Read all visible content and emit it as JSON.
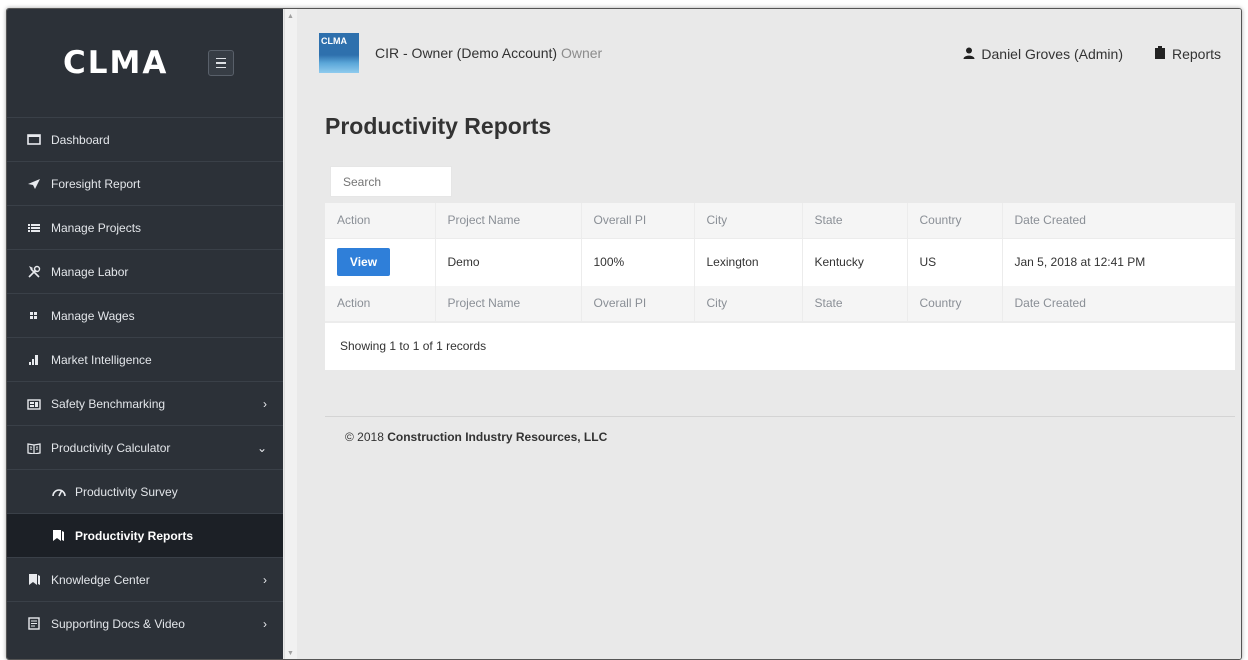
{
  "sidebar": {
    "brand": "CLMA",
    "items": [
      {
        "label": "Dashboard",
        "icon": "monitor-icon"
      },
      {
        "label": "Foresight Report",
        "icon": "paper-plane-icon"
      },
      {
        "label": "Manage Projects",
        "icon": "list-icon"
      },
      {
        "label": "Manage Labor",
        "icon": "tools-icon"
      },
      {
        "label": "Manage Wages",
        "icon": "grid-icon"
      },
      {
        "label": "Market Intelligence",
        "icon": "bar-chart-icon"
      },
      {
        "label": "Safety Benchmarking",
        "icon": "id-card-icon",
        "chevron": "›"
      },
      {
        "label": "Productivity Calculator",
        "icon": "book-icon",
        "chevron": "⌄"
      },
      {
        "label": "Productivity Survey",
        "icon": "gauge-icon"
      },
      {
        "label": "Productivity Reports",
        "icon": "bookmark-icon"
      },
      {
        "label": "Knowledge Center",
        "icon": "bookmark-icon",
        "chevron": "›"
      },
      {
        "label": "Supporting Docs & Video",
        "icon": "document-icon",
        "chevron": "›"
      }
    ]
  },
  "header": {
    "logo_text": "CLMA",
    "account": "CIR - Owner (Demo Account)",
    "role": "Owner",
    "user": "Daniel Groves (Admin)",
    "reports": "Reports"
  },
  "page": {
    "title": "Productivity Reports",
    "search_placeholder": "Search"
  },
  "table": {
    "columns": [
      "Action",
      "Project Name",
      "Overall PI",
      "City",
      "State",
      "Country",
      "Date Created"
    ],
    "rows": [
      {
        "action": "View",
        "project_name": "Demo",
        "overall_pi": "100%",
        "city": "Lexington",
        "state": "Kentucky",
        "country": "US",
        "date_created": "Jan 5, 2018 at 12:41 PM"
      }
    ],
    "records_info": "Showing 1 to 1 of 1 records"
  },
  "footer": {
    "copyright": "© 2018",
    "company": "Construction Industry Resources, LLC"
  }
}
